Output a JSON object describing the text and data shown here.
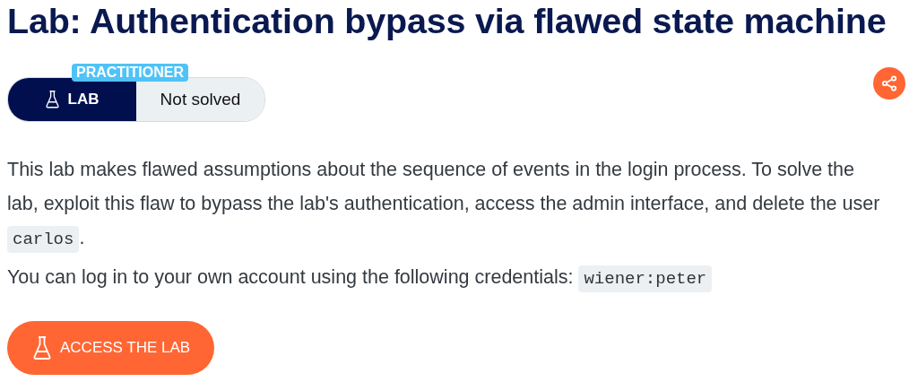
{
  "title": "Lab: Authentication bypass via flawed state machine",
  "level_badge": "PRACTITIONER",
  "lab_label": "LAB",
  "status": "Not solved",
  "paragraphs": [
    [
      {
        "kind": "text",
        "text": "This lab makes flawed assumptions about the sequence of events in the login process. To solve the "
      },
      {
        "kind": "line",
        "text": "lab, exploit this flaw to bypass the lab's authentication, access the admin interface, and delete the user"
      },
      {
        "kind": "code",
        "text": "carlos"
      },
      {
        "kind": "text",
        "text": "."
      }
    ],
    [
      {
        "kind": "text",
        "text": "You can log in to your own account using the following credentials: "
      },
      {
        "kind": "code",
        "text": "wiener:peter"
      }
    ]
  ],
  "access_button": "ACCESS THE LAB"
}
